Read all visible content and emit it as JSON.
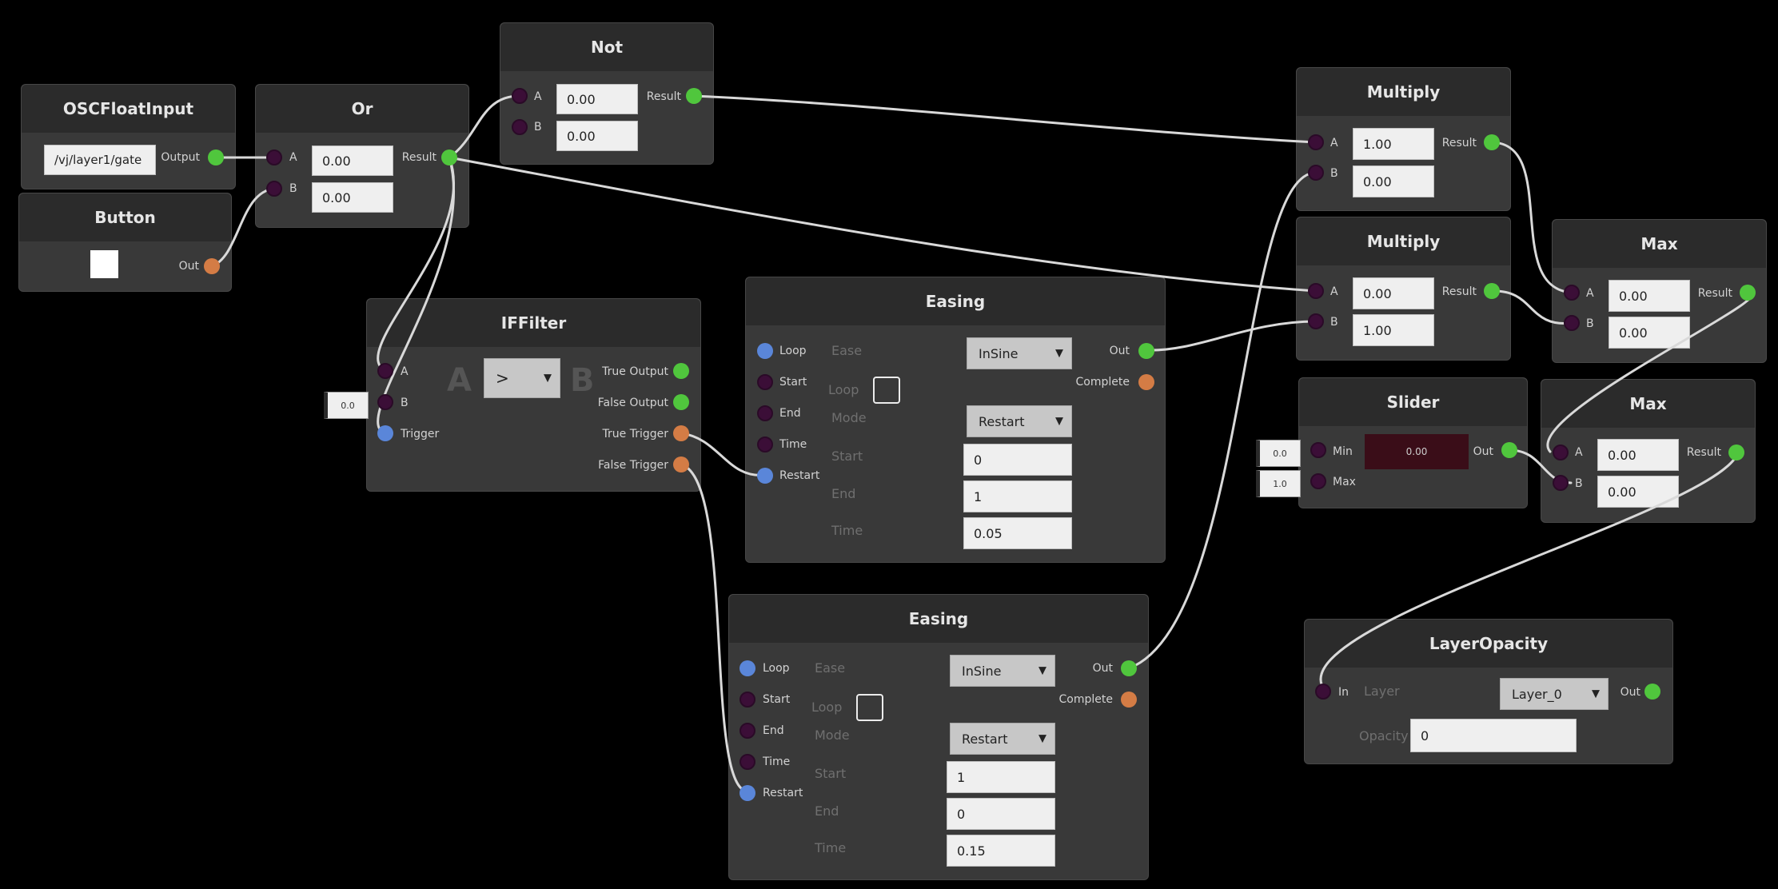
{
  "nodes": {
    "osc": {
      "title": "OSCFloatInput",
      "address": "/vj/layer1/gate",
      "out_label": "Output"
    },
    "button": {
      "title": "Button",
      "out_label": "Out"
    },
    "or": {
      "title": "Or",
      "a_label": "A",
      "b_label": "B",
      "a_value": "0.00",
      "b_value": "0.00",
      "out_label": "Result"
    },
    "not": {
      "title": "Not",
      "a_label": "A",
      "b_label": "B",
      "a_value": "0.00",
      "b_value": "0.00",
      "out_label": "Result"
    },
    "iffilter": {
      "title": "IFFilter",
      "a_label": "A",
      "b_label": "B",
      "trigger_label": "Trigger",
      "b_side_value": "0.0",
      "operator": ">",
      "big_a": "A",
      "big_b": "B",
      "true_output": "True Output",
      "false_output": "False Output",
      "true_trigger": "True Trigger",
      "false_trigger": "False Trigger"
    },
    "easing1": {
      "title": "Easing",
      "inputs": [
        "Loop",
        "Start",
        "End",
        "Time",
        "Restart"
      ],
      "ease_label": "Ease",
      "ease_value": "InSine",
      "loop_label": "Loop",
      "mode_label": "Mode",
      "mode_value": "Restart",
      "start_label": "Start",
      "start_value": "0",
      "end_label": "End",
      "end_value": "1",
      "time_label": "Time",
      "time_value": "0.05",
      "out_label": "Out",
      "complete_label": "Complete"
    },
    "easing2": {
      "title": "Easing",
      "inputs": [
        "Loop",
        "Start",
        "End",
        "Time",
        "Restart"
      ],
      "ease_label": "Ease",
      "ease_value": "InSine",
      "loop_label": "Loop",
      "mode_label": "Mode",
      "mode_value": "Restart",
      "start_label": "Start",
      "start_value": "1",
      "end_label": "End",
      "end_value": "0",
      "time_label": "Time",
      "time_value": "0.15",
      "out_label": "Out",
      "complete_label": "Complete"
    },
    "multiply1": {
      "title": "Multiply",
      "a_label": "A",
      "b_label": "B",
      "a_value": "1.00",
      "b_value": "0.00",
      "out_label": "Result"
    },
    "multiply2": {
      "title": "Multiply",
      "a_label": "A",
      "b_label": "B",
      "a_value": "0.00",
      "b_value": "1.00",
      "out_label": "Result"
    },
    "max1": {
      "title": "Max",
      "a_label": "A",
      "b_label": "B",
      "a_value": "0.00",
      "b_value": "0.00",
      "out_label": "Result"
    },
    "max2": {
      "title": "Max",
      "a_label": "A",
      "b_label": "B",
      "a_value": "0.00",
      "b_value": "0.00",
      "out_label": "Result"
    },
    "slider": {
      "title": "Slider",
      "min_label": "Min",
      "max_label": "Max",
      "min_side_value": "0.0",
      "max_side_value": "1.0",
      "value": "0.00",
      "out_label": "Out"
    },
    "layeropacity": {
      "title": "LayerOpacity",
      "in_label": "In",
      "layer_label": "Layer",
      "layer_value": "Layer_0",
      "opacity_label": "Opacity",
      "opacity_value": "0",
      "out_label": "Out"
    }
  },
  "colors": {
    "background": "#000000",
    "node": "#393939",
    "header": "#2b2b2b",
    "port_float_out": "#50c63d",
    "port_trigger": "#d47c45",
    "port_in": "#3b0e37",
    "port_restart": "#5a86d9",
    "wire": "#d9d9d9"
  }
}
